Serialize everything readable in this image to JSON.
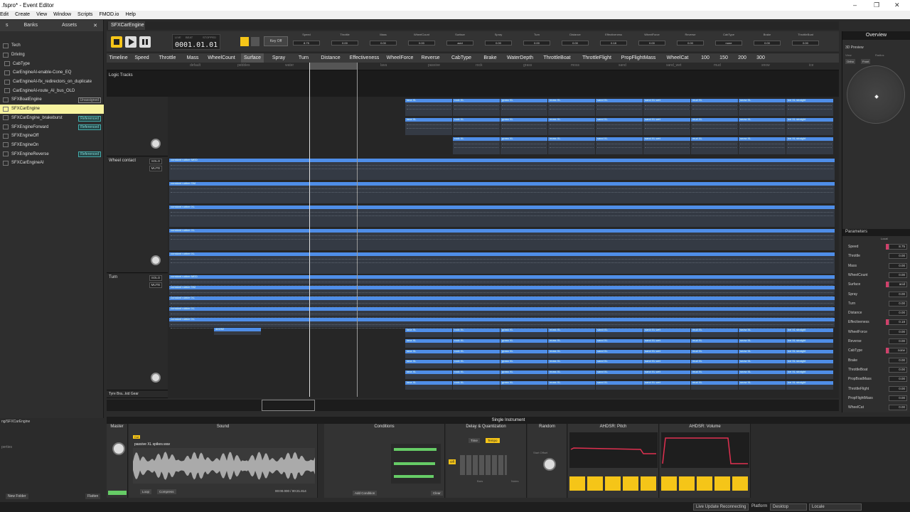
{
  "window": {
    "title": ".fspro* - Event Editor"
  },
  "menu": [
    "Edit",
    "Create",
    "View",
    "Window",
    "Scripts",
    "FMOD.io",
    "Help"
  ],
  "browser": {
    "tabs": [
      "s",
      "Banks",
      "Assets"
    ],
    "items": [
      {
        "label": "Tech",
        "badge": ""
      },
      {
        "label": "Driving",
        "badge": ""
      },
      {
        "label": "CabType",
        "badge": ""
      },
      {
        "label": "CarEngineAI-enable-Cone_EQ",
        "badge": ""
      },
      {
        "label": "CarEngineAI-fix_redirectors_on_duplicate",
        "badge": ""
      },
      {
        "label": "CarEngineAI-route_AI_bus_OLD",
        "badge": ""
      },
      {
        "label": "SFXBoatEngine",
        "badge": "Unassigned"
      },
      {
        "label": "SFXCarEngine",
        "badge": ""
      },
      {
        "label": "SFXCarEngine_brakeburst",
        "badge": "Referenced"
      },
      {
        "label": "SFXEngineForward",
        "badge": "Referenced"
      },
      {
        "label": "SFXEngineOff",
        "badge": ""
      },
      {
        "label": "SFXEngineOn",
        "badge": ""
      },
      {
        "label": "SFXEngineReverse",
        "badge": "Referenced"
      },
      {
        "label": "SFXCarEngineAI",
        "badge": ""
      }
    ],
    "path": "ng/SFXCarEngine",
    "props": "perties",
    "new_folder": "New Folder",
    "flatten": "Flatten"
  },
  "event_tab": "SFXCarEngine",
  "transport": {
    "time": "0001.01.01",
    "key_off": "Key Off",
    "live": "LIVE",
    "beat": "BEAT",
    "stopped": "STOPPED"
  },
  "param_tabs": [
    "Timeline",
    "Speed",
    "Throttle",
    "Mass",
    "WheelCount",
    "Surface",
    "Spray",
    "Turn",
    "Distance",
    "Effectiveness",
    "WheelForce",
    "Reverse",
    "CabType",
    "Brake",
    "WaterDepth",
    "ThrottleBoat",
    "ThrottleFlight",
    "PropFlightMass",
    "WheelCat",
    "100",
    "150",
    "200",
    "300"
  ],
  "selected_param_tab": "Surface",
  "ruler": [
    "default",
    "pebbles",
    "water",
    "acid",
    "lava",
    "passive",
    "rock",
    "grass",
    "moss",
    "sand",
    "sand_wet",
    "mud",
    "snow",
    "ice"
  ],
  "logic_tracks": "Logic Tracks",
  "track_names": [
    "Wheel contact",
    "Turn",
    "Tyre Bra...kid Gear"
  ],
  "solo": "SOLO",
  "mute": "MUTE",
  "lanes": {
    "top": [
      "lava XL",
      "rock XL",
      "grass XL",
      "moss XL",
      "sand XL",
      "sand XL wet",
      "mud XL",
      "snow XL",
      "ice XL straight"
    ],
    "wheel": [
      "constant rubber MED",
      "constant rubber SM",
      "constant rubber XL",
      "constant rubber XL",
      "constant rubber XL"
    ],
    "turn": [
      "constant rubber MED",
      "constant rubber SM",
      "constant rubber XL",
      "constant rubber XL",
      "constant rubber XL"
    ],
    "tyre_small": "dirt252"
  },
  "preview": {
    "title": "Overview",
    "sub": "3D Preview",
    "view": "View",
    "ortho": "Ortho",
    "front": "Front",
    "radius": "Radius"
  },
  "parameters": {
    "title": "Parameters",
    "local": "Local",
    "rows": [
      {
        "n": "Speed",
        "v": "8.75"
      },
      {
        "n": "Throttle",
        "v": "0.00"
      },
      {
        "n": "Mass",
        "v": "0.00"
      },
      {
        "n": "WheelCount",
        "v": "0.00"
      },
      {
        "n": "Surface",
        "v": "acid"
      },
      {
        "n": "Spray",
        "v": "0.00"
      },
      {
        "n": "Turn",
        "v": "0.00"
      },
      {
        "n": "Distance",
        "v": "0.00"
      },
      {
        "n": "Effectiveness",
        "v": "0.18"
      },
      {
        "n": "WheelForce",
        "v": "0.00"
      },
      {
        "n": "Reverse",
        "v": "0.00"
      },
      {
        "n": "CabType",
        "v": "none"
      },
      {
        "n": "Brake",
        "v": "0.00"
      },
      {
        "n": "ThrottleBoat",
        "v": "0.00"
      },
      {
        "n": "PropBoatMass",
        "v": "0.00"
      },
      {
        "n": "ThrottleFlight",
        "v": "0.00"
      },
      {
        "n": "PropFlightMass",
        "v": "0.00"
      },
      {
        "n": "WheelCat",
        "v": "0.00"
      }
    ]
  },
  "deck": {
    "title": "Single Instrument",
    "master": "Master",
    "sound": "Sound",
    "conditions": "Conditions",
    "delay": "Delay & Quantization",
    "random": "Random",
    "ahdsr_pitch": "AHDSR: Pitch",
    "ahdsr_volume": "AHDSR: Volume",
    "file": "passive XL spikes.wav",
    "time_readout": "00:00.000 / 00:21.814",
    "loop": "Loop",
    "compress": "Compress",
    "cut": "Cut",
    "add_condition": "Add Condition",
    "clear": "Clear",
    "time": "Time",
    "tempo": "Tempo",
    "off": "Off",
    "bars": "Bars",
    "notes": "Notes",
    "start_offset": "Start Offset"
  },
  "status": {
    "live_update": "Live Update Reconnecting",
    "platform": "Platform",
    "desktop": "Desktop",
    "locale": "Locale"
  },
  "colors": {
    "accent": "#4f8ee8",
    "selected": "#f8f4a0",
    "pink": "#d0406a"
  }
}
